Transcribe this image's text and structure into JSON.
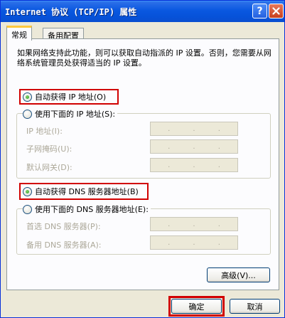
{
  "window": {
    "title": "Internet 协议 (TCP/IP) 属性",
    "help_label": "?"
  },
  "tabs": [
    {
      "label": "常规",
      "active": true
    },
    {
      "label": "备用配置",
      "active": false
    }
  ],
  "description": "如果网络支持此功能，则可以获取自动指派的 IP 设置。否则，您需要从网络系统管理员处获得适当的 IP 设置。",
  "ip_section": {
    "auto_label": "自动获得 IP 地址(O)",
    "auto_selected": true,
    "manual_label": "使用下面的 IP 地址(S):",
    "fields": [
      {
        "label": "IP 地址(I):"
      },
      {
        "label": "子网掩码(U):"
      },
      {
        "label": "默认网关(D):"
      }
    ]
  },
  "dns_section": {
    "auto_label": "自动获得 DNS 服务器地址(B)",
    "auto_selected": true,
    "manual_label": "使用下面的 DNS 服务器地址(E):",
    "fields": [
      {
        "label": "首选 DNS 服务器(P):"
      },
      {
        "label": "备用 DNS 服务器(A):"
      }
    ]
  },
  "buttons": {
    "advanced": "高级(V)...",
    "ok": "确定",
    "cancel": "取消"
  },
  "colors": {
    "highlight_border": "#d10000",
    "titlebar": "#0a58e0"
  }
}
